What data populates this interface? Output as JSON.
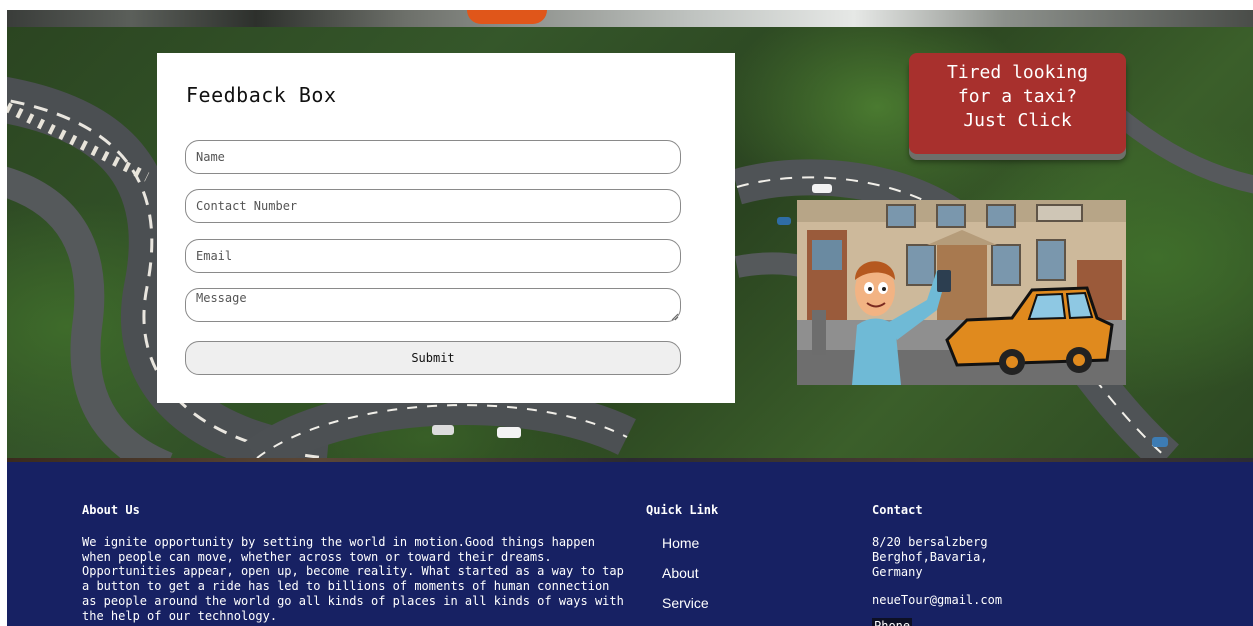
{
  "feedback": {
    "title": "Feedback Box",
    "name_placeholder": "Name",
    "contact_placeholder": "Contact Number",
    "email_placeholder": "Email",
    "message_placeholder": "Message",
    "submit_label": "Submit"
  },
  "callout": {
    "line1": "Tired looking",
    "line2": "for a taxi?",
    "line3": "Just Click"
  },
  "footer": {
    "about_title": "About Us",
    "about_text": "We ignite opportunity by setting the world in motion.Good things happen when people can move, whether across town or toward their dreams. Opportunities appear, open up, become reality. What started as a way to tap a button to get a ride has led to billions of moments of human connection as people around the world go all kinds of places in all kinds of ways with the help of our technology.",
    "quick_title": "Quick Link",
    "quick_links": [
      "Home",
      "About",
      "Service"
    ],
    "contact_title": "Contact",
    "address_line1": "8/20 bersalzberg",
    "address_line2": "Berghof,Bavaria,",
    "address_line3": "Germany",
    "email": "neueTour@gmail.com",
    "phone_label": "Phone"
  },
  "colors": {
    "footer_bg": "#172163",
    "callout_bg": "#a8302d"
  }
}
